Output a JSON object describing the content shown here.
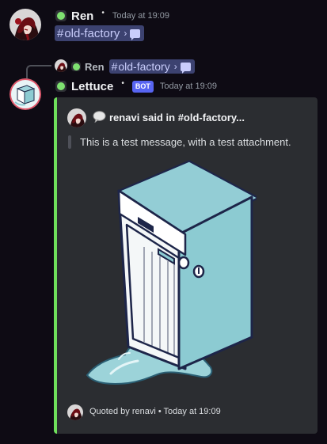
{
  "message1": {
    "author": "Ren",
    "timestamp": "Today at 19:09",
    "channel": "old-factory"
  },
  "message2": {
    "reply": {
      "author": "Ren",
      "channel": "old-factory"
    },
    "author": "Lettuce",
    "bot_tag": "BOT",
    "timestamp": "Today at 19:09",
    "embed": {
      "author_text": "renavi said in #old-factory...",
      "description": "This is a test message, with a test attachment.",
      "footer": "Quoted by renavi • Today at 19:09",
      "accent_color": "#6fe05b"
    }
  },
  "colors": {
    "background": "#0e0b14",
    "embed_bg": "#2b2d31",
    "online": "#7ee070",
    "mention_bg": "#3c4270",
    "bot_tag": "#5865f2",
    "dishwasher": "#8ccbd2"
  },
  "icons": {
    "role": "sprout-icon",
    "channel_thread": "thread-chat-icon",
    "embed_author": "speech-bubble-icon"
  }
}
